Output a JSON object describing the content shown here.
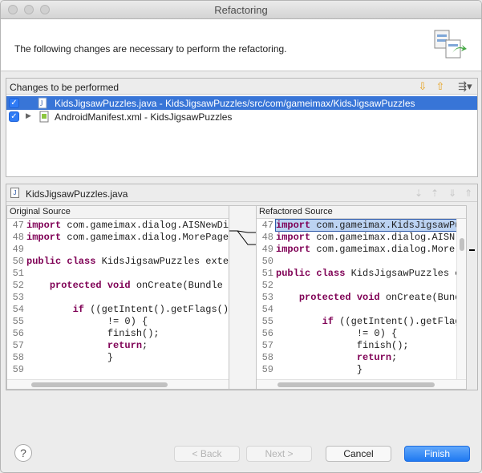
{
  "window": {
    "title": "Refactoring"
  },
  "header": {
    "message": "The following changes are necessary to perform the refactoring."
  },
  "changes": {
    "label": "Changes to be performed",
    "items": [
      {
        "text": "KidsJigsawPuzzles.java - KidsJigsawPuzzles/src/com/gameimax/KidsJigsawPuzzles",
        "checked": true,
        "selected": true
      },
      {
        "text": "AndroidManifest.xml - KidsJigsawPuzzles",
        "checked": true,
        "selected": false
      }
    ]
  },
  "compare": {
    "file": "KidsJigsawPuzzles.java",
    "original": {
      "label": "Original Source",
      "lines": [
        {
          "n": "47",
          "kw": "import",
          "rest": " com.gameimax.dialog.AISNewDi"
        },
        {
          "n": "48",
          "kw": "import",
          "rest": " com.gameimax.dialog.MorePage"
        },
        {
          "n": "49",
          "kw": "",
          "rest": ""
        },
        {
          "n": "50",
          "kw": "public class",
          "rest": " KidsJigsawPuzzles exter"
        },
        {
          "n": "51",
          "kw": "",
          "rest": ""
        },
        {
          "n": "52",
          "kw": "",
          "rest": "    ",
          "kw2": "protected void",
          "rest2": " onCreate(Bundle s"
        },
        {
          "n": "53",
          "kw": "",
          "rest": ""
        },
        {
          "n": "54",
          "kw": "",
          "rest": "        ",
          "kw2": "if",
          "rest2": " ((getIntent().getFlags()"
        },
        {
          "n": "55",
          "kw": "",
          "rest": "              != 0) {"
        },
        {
          "n": "56",
          "kw": "",
          "rest": "              finish();"
        },
        {
          "n": "57",
          "kw": "",
          "rest": "              ",
          "kw2": "return",
          "rest2": ";"
        },
        {
          "n": "58",
          "kw": "",
          "rest": "              }"
        },
        {
          "n": "59",
          "kw": "",
          "rest": ""
        }
      ]
    },
    "refactored": {
      "label": "Refactored Source",
      "lines": [
        {
          "n": "47",
          "kw": "import",
          "rest": " com.gameimax.KidsJigsawPu",
          "hl": true
        },
        {
          "n": "48",
          "kw": "import",
          "rest": " com.gameimax.dialog.AISN"
        },
        {
          "n": "49",
          "kw": "import",
          "rest": " com.gameimax.dialog.More"
        },
        {
          "n": "50",
          "kw": "",
          "rest": ""
        },
        {
          "n": "51",
          "kw": "public class",
          "rest": " KidsJigsawPuzzles e"
        },
        {
          "n": "52",
          "kw": "",
          "rest": ""
        },
        {
          "n": "53",
          "kw": "",
          "rest": "    ",
          "kw2": "protected void",
          "rest2": " onCreate(Bund"
        },
        {
          "n": "54",
          "kw": "",
          "rest": ""
        },
        {
          "n": "55",
          "kw": "",
          "rest": "        ",
          "kw2": "if",
          "rest2": " ((getIntent().getFlag"
        },
        {
          "n": "56",
          "kw": "",
          "rest": "              != 0) {"
        },
        {
          "n": "57",
          "kw": "",
          "rest": "              finish();"
        },
        {
          "n": "58",
          "kw": "",
          "rest": "              ",
          "kw2": "return",
          "rest2": ";"
        },
        {
          "n": "59",
          "kw": "",
          "rest": "              }"
        }
      ]
    }
  },
  "buttons": {
    "back": "< Back",
    "next": "Next >",
    "cancel": "Cancel",
    "finish": "Finish"
  }
}
